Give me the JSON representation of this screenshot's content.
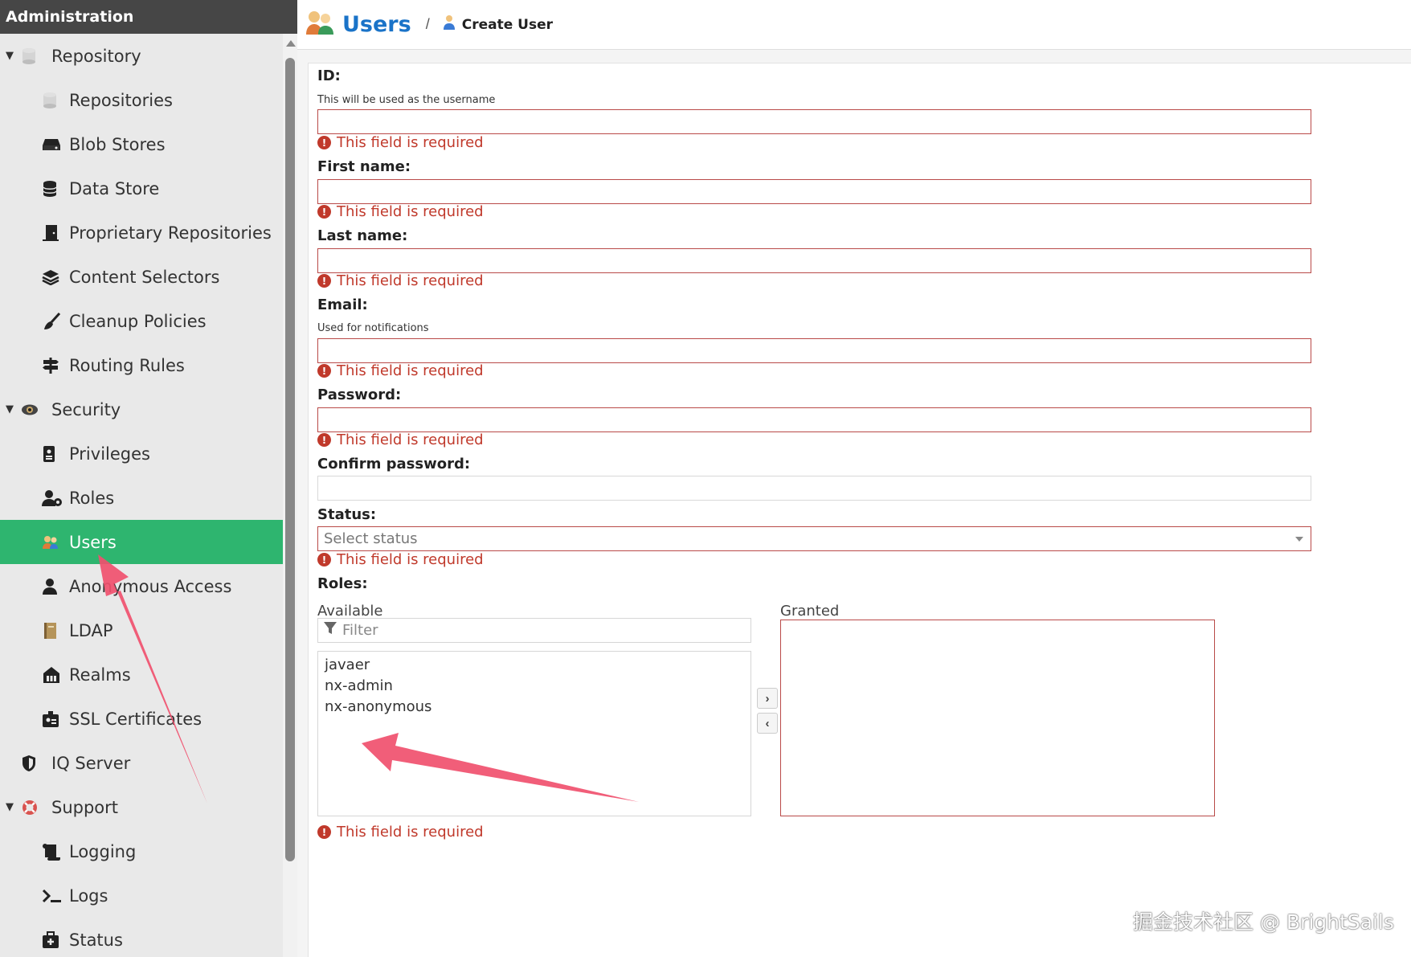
{
  "sidebar": {
    "header": "Administration",
    "items": [
      {
        "label": "Repository",
        "icon": "database-icon",
        "level": 0,
        "expanded": true
      },
      {
        "label": "Repositories",
        "icon": "database-icon",
        "level": 1
      },
      {
        "label": "Blob Stores",
        "icon": "hard-drive-icon",
        "level": 1
      },
      {
        "label": "Data Store",
        "icon": "database-stack-icon",
        "level": 1
      },
      {
        "label": "Proprietary Repositories",
        "icon": "door-icon",
        "level": 1
      },
      {
        "label": "Content Selectors",
        "icon": "layers-icon",
        "level": 1
      },
      {
        "label": "Cleanup Policies",
        "icon": "broom-icon",
        "level": 1
      },
      {
        "label": "Routing Rules",
        "icon": "signpost-icon",
        "level": 1
      },
      {
        "label": "Security",
        "icon": "eye-icon",
        "level": 0,
        "expanded": true
      },
      {
        "label": "Privileges",
        "icon": "id-badge-icon",
        "level": 1
      },
      {
        "label": "Roles",
        "icon": "users-cog-icon",
        "level": 1
      },
      {
        "label": "Users",
        "icon": "users-icon",
        "level": 1,
        "active": true
      },
      {
        "label": "Anonymous Access",
        "icon": "user-icon",
        "level": 1
      },
      {
        "label": "LDAP",
        "icon": "book-icon",
        "level": 1
      },
      {
        "label": "Realms",
        "icon": "realm-icon",
        "level": 1
      },
      {
        "label": "SSL Certificates",
        "icon": "certificate-icon",
        "level": 1
      },
      {
        "label": "IQ Server",
        "icon": "shield-icon",
        "level": 0,
        "expanded": false
      },
      {
        "label": "Support",
        "icon": "lifebuoy-icon",
        "level": 0,
        "expanded": true
      },
      {
        "label": "Logging",
        "icon": "scroll-icon",
        "level": 1
      },
      {
        "label": "Logs",
        "icon": "terminal-icon",
        "level": 1
      },
      {
        "label": "Status",
        "icon": "medkit-icon",
        "level": 1
      }
    ]
  },
  "header": {
    "title": "Users",
    "separator": "/",
    "subtitle": "Create User"
  },
  "form": {
    "id": {
      "label": "ID:",
      "help": "This will be used as the username",
      "value": "",
      "error": "This field is required"
    },
    "first_name": {
      "label": "First name:",
      "value": "",
      "error": "This field is required"
    },
    "last_name": {
      "label": "Last name:",
      "value": "",
      "error": "This field is required"
    },
    "email": {
      "label": "Email:",
      "help": "Used for notifications",
      "value": "",
      "error": "This field is required"
    },
    "password": {
      "label": "Password:",
      "value": "",
      "error": "This field is required"
    },
    "confirm_password": {
      "label": "Confirm password:",
      "value": ""
    },
    "status": {
      "label": "Status:",
      "placeholder": "Select status",
      "error": "This field is required"
    },
    "roles": {
      "label": "Roles:",
      "available_label": "Available",
      "granted_label": "Granted",
      "filter_placeholder": "Filter",
      "available": [
        "javaer",
        "nx-admin",
        "nx-anonymous"
      ],
      "granted": [],
      "error": "This field is required"
    }
  },
  "watermark": "掘金技术社区 @ BrightSails",
  "colors": {
    "accent": "#2eb56f",
    "title": "#1a73c8",
    "error": "#c0392b",
    "annotation": "#f0506e"
  }
}
